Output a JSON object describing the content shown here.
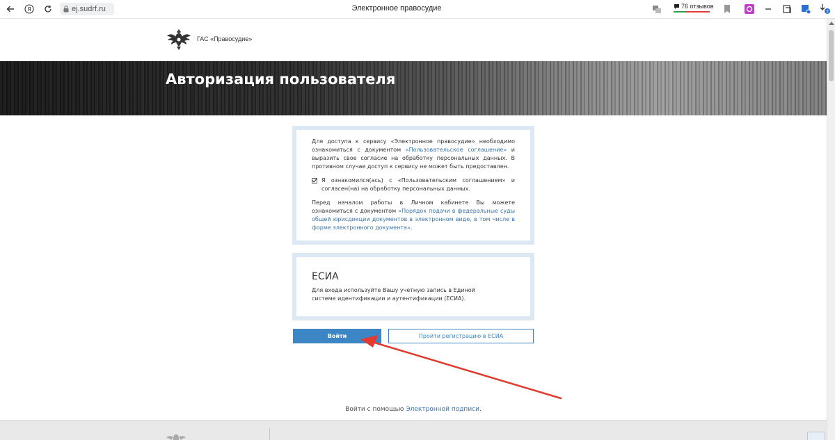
{
  "browser": {
    "url": "ej.sudrf.ru",
    "tab_title": "Электронное правосудие",
    "reviews_label": "76 отзывов",
    "download_badge": "3"
  },
  "header": {
    "brand": "ГАС «Правосудие»"
  },
  "banner": {
    "title": "Авторизация пользователя"
  },
  "agreement": {
    "intro_before_link": "Для доступа к сервису «Электронное правосудие» необходимо ознакомиться с документом ",
    "intro_link": "«Пользовательское соглашение»",
    "intro_after_link": " и выразить свое согласие на обработку персональных данных. В противном случае доступ к сервису не может быть предоставлен.",
    "checkbox_label": "Я ознакомился(ась) с «Пользовательским соглашением» и согласен(на) на обработку персональных данных.",
    "checkbox_checked": true,
    "before_work_text": "Перед началом работы в Личном кабинете Вы можете ознакомиться с документом ",
    "before_work_link": "«Порядок подачи в федеральные суды общей юрисдикции документов в электронном виде, в том числе в форме электронного документа»",
    "before_work_end": "."
  },
  "esia": {
    "title": "ЕСИА",
    "description": "Для входа используйте Вашу учетную запись в Единой системе идентификации и аутентификации (ЕСИА)."
  },
  "buttons": {
    "login": "Войти",
    "register": "Пройти регистрацию в ЕСИА"
  },
  "signature": {
    "prefix": "Войти с помощью ",
    "link": "Электронной подписи",
    "suffix": "."
  },
  "colors": {
    "accent": "#3d86c6",
    "card_border": "#dce9f4",
    "link": "#3a73b0",
    "arrow": "#e23a2e"
  }
}
